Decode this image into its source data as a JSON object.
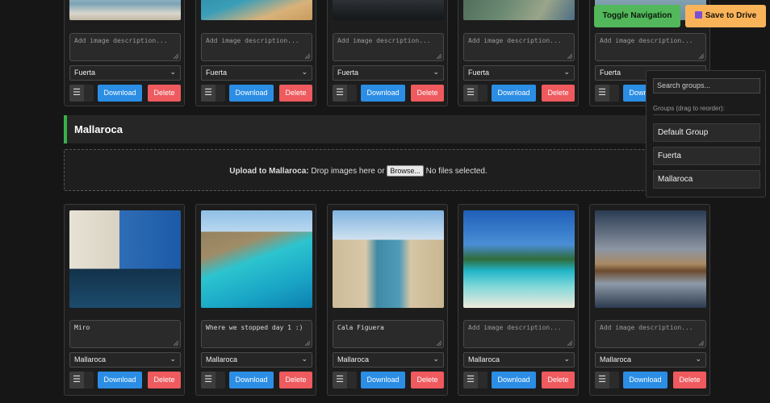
{
  "toolbar": {
    "toggle_navigation": "Toggle Navigation",
    "save_to_drive": "Save to Drive",
    "save_icon": "floppy-disk-icon"
  },
  "group_panel": {
    "search_placeholder": "Search groups...",
    "hint": "Groups (drag to reorder):",
    "groups": [
      "Default Group",
      "Fuerta",
      "Mallaroca"
    ]
  },
  "card_labels": {
    "download": "Download",
    "delete": "Delete",
    "drag_handle": "☰",
    "placeholder": "Add image description..."
  },
  "top_row": {
    "group": "Fuerta",
    "cards": [
      {
        "description": "",
        "group": "Fuerta"
      },
      {
        "description": "",
        "group": "Fuerta"
      },
      {
        "description": "",
        "group": "Fuerta"
      },
      {
        "description": "",
        "group": "Fuerta"
      },
      {
        "description": "",
        "group": "Fuerta"
      }
    ]
  },
  "section": {
    "title": "Mallaroca",
    "upload_label": "Upload to Mallaroca:",
    "upload_text": "Drop images here or",
    "browse_button": "Browse...",
    "file_status": "No files selected."
  },
  "bottom_row": {
    "cards": [
      {
        "description": "Miro",
        "group": "Mallaroca"
      },
      {
        "description": "Where we stopped day 1 :)",
        "group": "Mallaroca"
      },
      {
        "description": "Cala Figuera",
        "group": "Mallaroca"
      },
      {
        "description": "",
        "group": "Mallaroca"
      },
      {
        "description": "",
        "group": "Mallaroca"
      }
    ]
  },
  "colors": {
    "accent_green": "#38b24a",
    "download_blue": "#2b8de4",
    "delete_red": "#ee5a5e",
    "save_orange": "#f9b45a",
    "toggle_green": "#52b85b"
  }
}
